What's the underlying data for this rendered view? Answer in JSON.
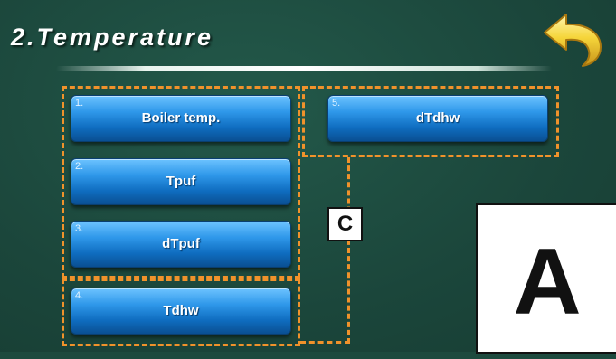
{
  "screen": {
    "title": "2.Temperature",
    "back_icon": "curved-back-arrow-icon"
  },
  "menu": {
    "items": [
      {
        "number": "1.",
        "label": "Boiler temp."
      },
      {
        "number": "2.",
        "label": "Tpuf"
      },
      {
        "number": "3.",
        "label": "dTpuf"
      },
      {
        "number": "4.",
        "label": "Tdhw"
      },
      {
        "number": "5.",
        "label": "dTdhw"
      }
    ]
  },
  "annotations": {
    "c_label": "C",
    "a_label": "A",
    "highlight_color": "#f0922b"
  },
  "colors": {
    "background": "#1d4a3e",
    "button_blue": "#1e84d6",
    "back_arrow": "#f2d23c"
  }
}
